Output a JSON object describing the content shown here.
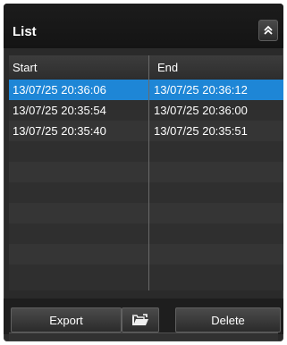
{
  "panel": {
    "title": "List"
  },
  "table": {
    "columns": [
      "Start",
      "End"
    ],
    "rows": [
      {
        "start": "13/07/25 20:36:06",
        "end": "13/07/25 20:36:12",
        "selected": true
      },
      {
        "start": "13/07/25 20:35:54",
        "end": "13/07/25 20:36:00",
        "selected": false
      },
      {
        "start": "13/07/25 20:35:40",
        "end": "13/07/25 20:35:51",
        "selected": false
      }
    ],
    "selection_color": "#1e86d6"
  },
  "toolbar": {
    "export_label": "Export",
    "open_icon": "folder-open-icon",
    "delete_label": "Delete"
  },
  "icons": {
    "collapse": "double-chevron-up-icon"
  }
}
